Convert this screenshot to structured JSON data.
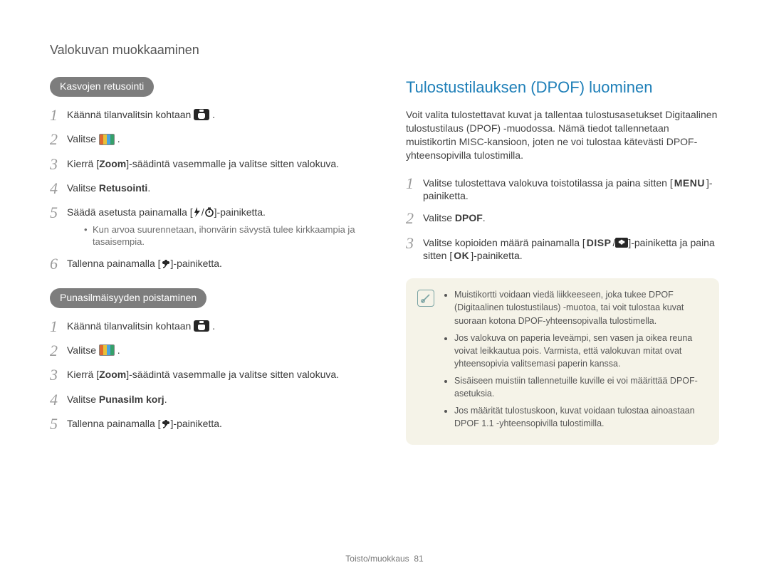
{
  "page_title": "Valokuvan muokkaaminen",
  "left": {
    "section1": {
      "pill": "Kasvojen retusointi",
      "step1_a": "Käännä tilanvalitsin kohtaan ",
      "step1_b": ".",
      "step2_a": "Valitse ",
      "step2_b": ".",
      "step3_a": "Kierrä [",
      "step3_zoom": "Zoom",
      "step3_b": "]-säädintä vasemmalle ja valitse sitten valokuva.",
      "step4_a": "Valitse ",
      "step4_bold": "Retusointi",
      "step4_b": ".",
      "step5_a": "Säädä asetusta painamalla [",
      "step5_mid": "/",
      "step5_b": "]-painiketta.",
      "step5_sub": "Kun arvoa suurennetaan, ihonvärin sävystä tulee kirkkaampia ja tasaisempia.",
      "step6_a": "Tallenna painamalla [",
      "step6_b": "]-painiketta."
    },
    "section2": {
      "pill": "Punasilmäisyyden poistaminen",
      "step1_a": "Käännä tilanvalitsin kohtaan ",
      "step1_b": ".",
      "step2_a": "Valitse ",
      "step2_b": ".",
      "step3_a": "Kierrä [",
      "step3_zoom": "Zoom",
      "step3_b": "]-säädintä vasemmalle ja valitse sitten valokuva.",
      "step4_a": "Valitse ",
      "step4_bold": "Punasilm korj",
      "step4_b": ".",
      "step5_a": "Tallenna painamalla [",
      "step5_b": "]-painiketta."
    }
  },
  "right": {
    "heading": "Tulostustilauksen (DPOF) luominen",
    "intro": "Voit valita tulostettavat kuvat ja tallentaa tulostusasetukset Digitaalinen tulostustilaus (DPOF) -muodossa. Nämä tiedot tallennetaan muistikortin MISC-kansioon, joten ne voi tulostaa kätevästi DPOF-yhteensopivilla tulostimilla.",
    "step1_a": "Valitse tulostettava valokuva toistotilassa ja paina sitten [",
    "step1_btn": "MENU",
    "step1_b": "]-painiketta.",
    "step2_a": "Valitse ",
    "step2_bold": "DPOF",
    "step2_b": ".",
    "step3_a": "Valitse kopioiden määrä painamalla [",
    "step3_disp": "DISP",
    "step3_mid": "/",
    "step3_b": "]-painiketta ja paina sitten [",
    "step3_ok": "OK",
    "step3_c": "]-painiketta.",
    "notes": [
      "Muistikortti voidaan viedä liikkeeseen, joka tukee DPOF (Digitaalinen tulostustilaus) -muotoa, tai voit tulostaa kuvat suoraan kotona DPOF-yhteensopivalla tulostimella.",
      "Jos valokuva on paperia leveämpi, sen vasen ja oikea reuna voivat leikkautua pois. Varmista, että valokuvan mitat ovat yhteensopivia valitsemasi paperin kanssa.",
      "Sisäiseen muistiin tallennetuille kuville ei voi määrittää DPOF-asetuksia.",
      "Jos määrität tulostuskoon, kuvat voidaan tulostaa ainoastaan DPOF 1.1 -yhteensopivilla tulostimilla."
    ]
  },
  "footer_a": "Toisto/muokkaus",
  "footer_page": "81"
}
